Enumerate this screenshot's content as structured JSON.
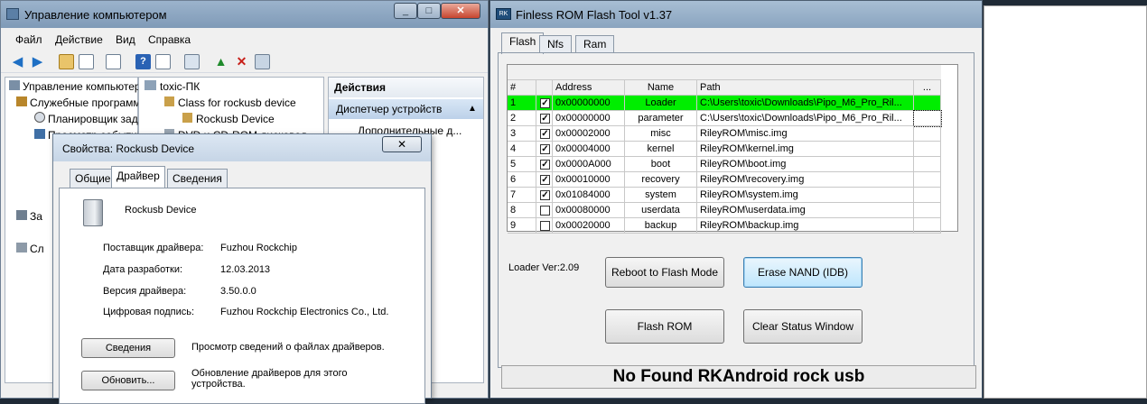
{
  "computer_management": {
    "title": "Управление компьютером",
    "menu": [
      "Файл",
      "Действие",
      "Вид",
      "Справка"
    ],
    "tree": [
      "Управление компьютером (локальным)",
      "Служебные программы",
      "Планировщик заданий",
      "Просмотр событий",
      "За",
      "Сл"
    ],
    "device_tree": [
      "toxic-ПК",
      "Class for rockusb device",
      "Rockusb Device",
      "DVD и CD-ROM дисковод"
    ],
    "actions": {
      "header": "Действия",
      "section": "Диспетчер устройств",
      "more": "Дополнительные д..."
    }
  },
  "properties_dialog": {
    "title": "Свойства: Rockusb Device",
    "close": "✕",
    "tabs": [
      "Общие",
      "Драйвер",
      "Сведения"
    ],
    "device_name": "Rockusb Device",
    "fields": [
      {
        "label": "Поставщик драйвера:",
        "value": "Fuzhou Rockchip"
      },
      {
        "label": "Дата разработки:",
        "value": "12.03.2013"
      },
      {
        "label": "Версия драйвера:",
        "value": "3.50.0.0"
      },
      {
        "label": "Цифровая подпись:",
        "value": "Fuzhou Rockchip Electronics Co., Ltd."
      }
    ],
    "buttons": [
      {
        "label": "Сведения",
        "desc": "Просмотр сведений о файлах драйверов."
      },
      {
        "label": "Обновить...",
        "desc": "Обновление драйверов для этого устройства."
      }
    ]
  },
  "flash_tool": {
    "title": "Finless ROM Flash Tool v1.37",
    "tabs": [
      "Flash",
      "Nfs",
      "Ram"
    ],
    "columns": [
      "#",
      "",
      "Address",
      "Name",
      "Path",
      "..."
    ],
    "rows": [
      {
        "n": "1",
        "checked": true,
        "address": "0x00000000",
        "name": "Loader",
        "path": "C:\\Users\\toxic\\Downloads\\Pipo_M6_Pro_Ril...",
        "highlight": true
      },
      {
        "n": "2",
        "checked": true,
        "address": "0x00000000",
        "name": "parameter",
        "path": "C:\\Users\\toxic\\Downloads\\Pipo_M6_Pro_Ril...",
        "highlight": false
      },
      {
        "n": "3",
        "checked": true,
        "address": "0x00002000",
        "name": "misc",
        "path": "RileyROM\\misc.img",
        "highlight": false
      },
      {
        "n": "4",
        "checked": true,
        "address": "0x00004000",
        "name": "kernel",
        "path": "RileyROM\\kernel.img",
        "highlight": false
      },
      {
        "n": "5",
        "checked": true,
        "address": "0x0000A000",
        "name": "boot",
        "path": "RileyROM\\boot.img",
        "highlight": false
      },
      {
        "n": "6",
        "checked": true,
        "address": "0x00010000",
        "name": "recovery",
        "path": "RileyROM\\recovery.img",
        "highlight": false
      },
      {
        "n": "7",
        "checked": true,
        "address": "0x01084000",
        "name": "system",
        "path": "RileyROM\\system.img",
        "highlight": false
      },
      {
        "n": "8",
        "checked": false,
        "address": "0x00080000",
        "name": "userdata",
        "path": "RileyROM\\userdata.img",
        "highlight": false
      },
      {
        "n": "9",
        "checked": false,
        "address": "0x00020000",
        "name": "backup",
        "path": "RileyROM\\backup.img",
        "highlight": false
      }
    ],
    "loader_ver": "Loader Ver:2.09",
    "buttons": {
      "reboot": "Reboot to Flash Mode",
      "erase": "Erase NAND (IDB)",
      "flash": "Flash ROM",
      "clear": "Clear Status Window"
    },
    "status": "No Found RKAndroid rock usb",
    "colors": {
      "highlight_row": "#00ee00"
    }
  }
}
